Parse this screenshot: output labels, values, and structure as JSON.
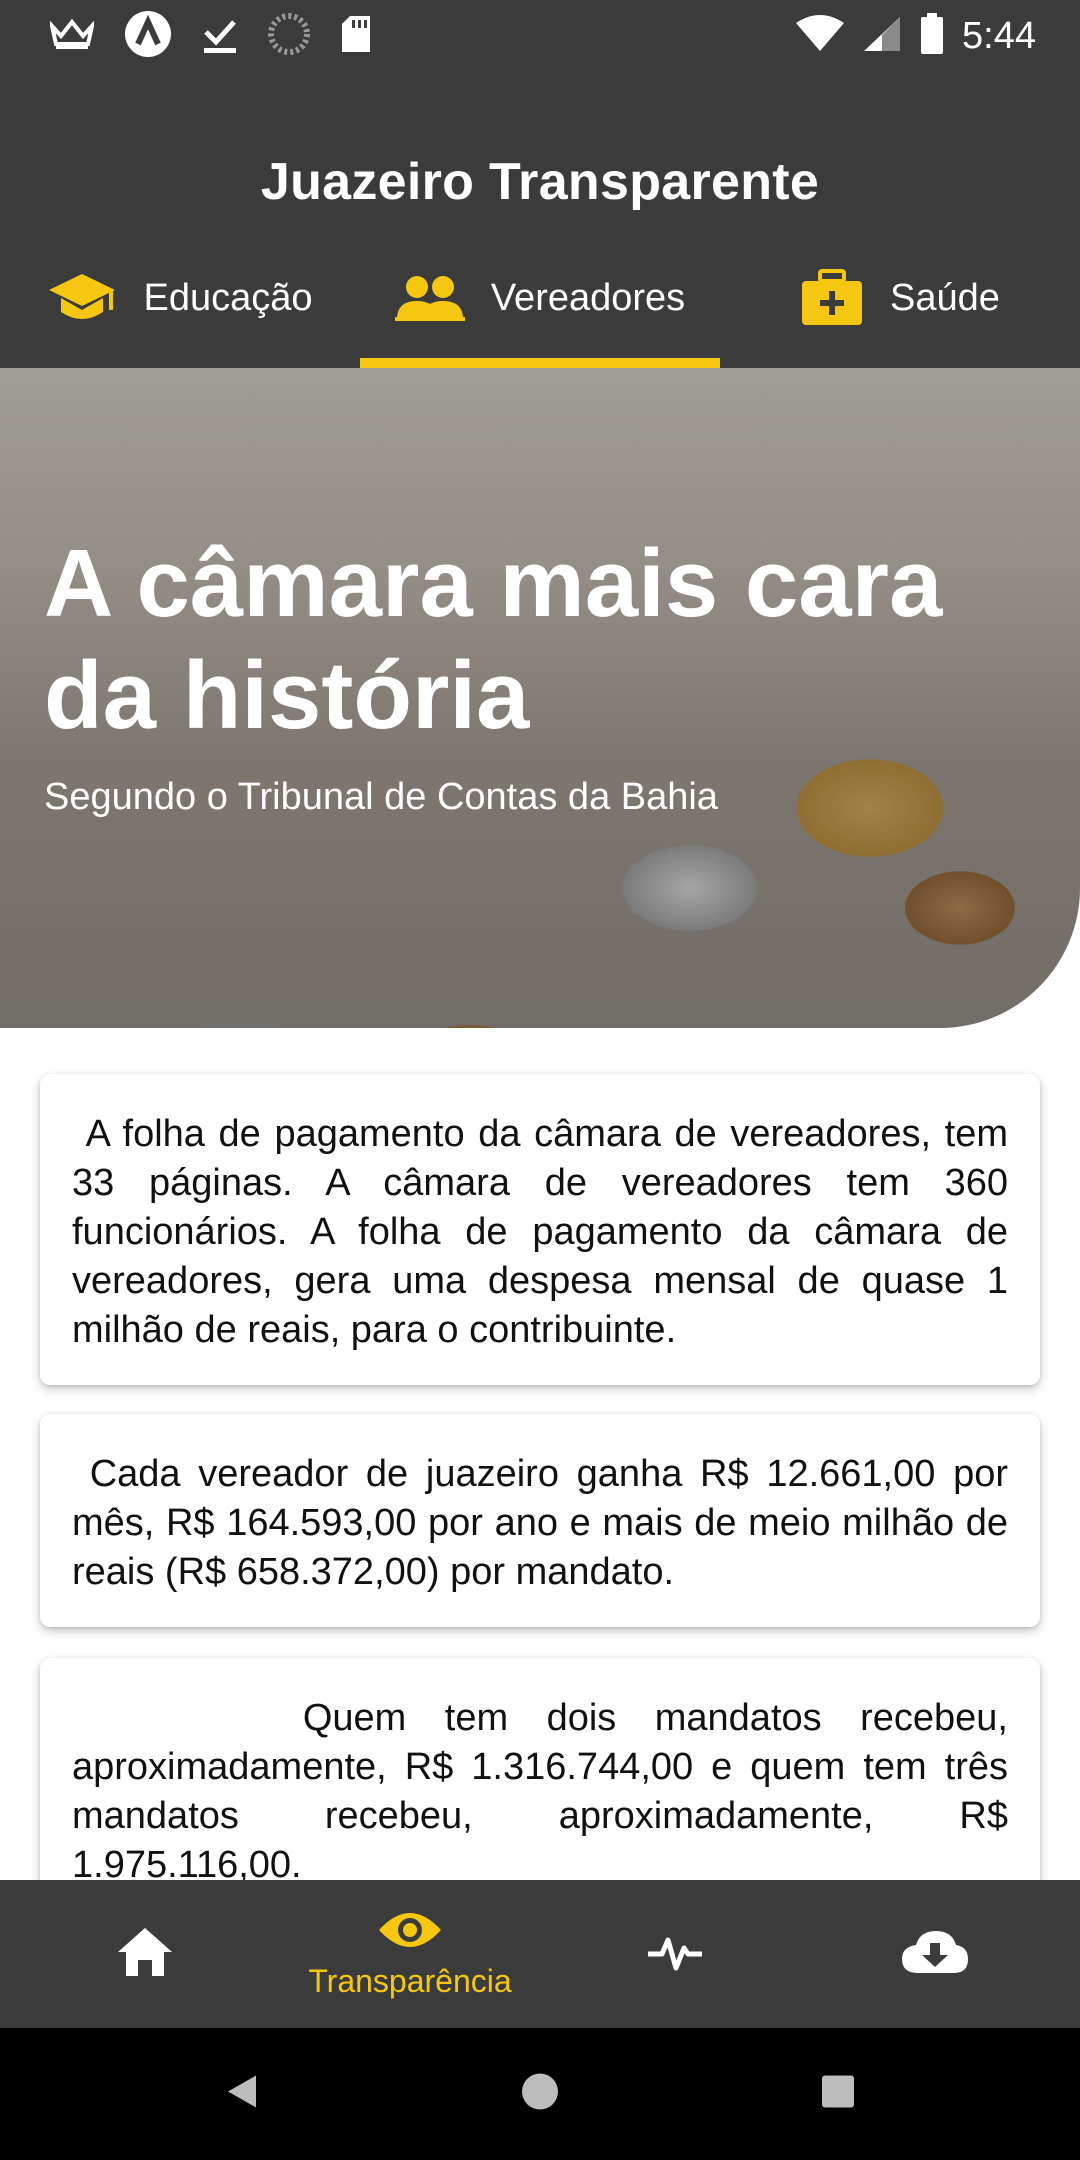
{
  "status_bar": {
    "time": "5:44",
    "left_icons": [
      "crown-icon",
      "launcher-icon",
      "download-done-icon",
      "loading-icon",
      "sd-card-icon"
    ],
    "right_icons": [
      "wifi-icon",
      "signal-icon",
      "battery-icon"
    ]
  },
  "app_bar": {
    "title": "Juazeiro Transparente"
  },
  "tabs": [
    {
      "label": "Educação",
      "icon": "graduation-cap-icon",
      "selected": false
    },
    {
      "label": "Vereadores",
      "icon": "users-icon",
      "selected": true
    },
    {
      "label": "Saúde",
      "icon": "medkit-icon",
      "selected": false
    }
  ],
  "hero": {
    "title": "A câmara mais cara da história",
    "subtitle": "Segundo o Tribunal de Contas da Bahia"
  },
  "cards": [
    {
      "text": " A folha de pagamento da câmara de vereadores, tem 33 páginas. A câmara de vereadores tem 360 funcionários. A folha de pagamento da câmara de vereadores, gera uma despesa mensal de quase 1 milhão de reais, para o contribuinte."
    },
    {
      "text": " Cada vereador de juazeiro ganha R$ 12.661,00 por mês, R$ 164.593,00 por ano e mais de meio milhão de reais (R$ 658.372,00) por mandato."
    },
    {
      "text": "      Quem tem dois mandatos recebeu, aproximadamente, R$ 1.316.744,00 e quem tem três mandatos recebeu, aproximadamente, R$ 1.975.116,00."
    }
  ],
  "bottom_nav": [
    {
      "icon": "home-icon",
      "label": ""
    },
    {
      "icon": "eye-icon",
      "label": "Transparência",
      "selected": true
    },
    {
      "icon": "pulse-icon",
      "label": ""
    },
    {
      "icon": "cloud-download-icon",
      "label": ""
    }
  ],
  "colors": {
    "bar": "#3b3b3b",
    "accent": "#f5c710",
    "system_nav": "#000000"
  }
}
